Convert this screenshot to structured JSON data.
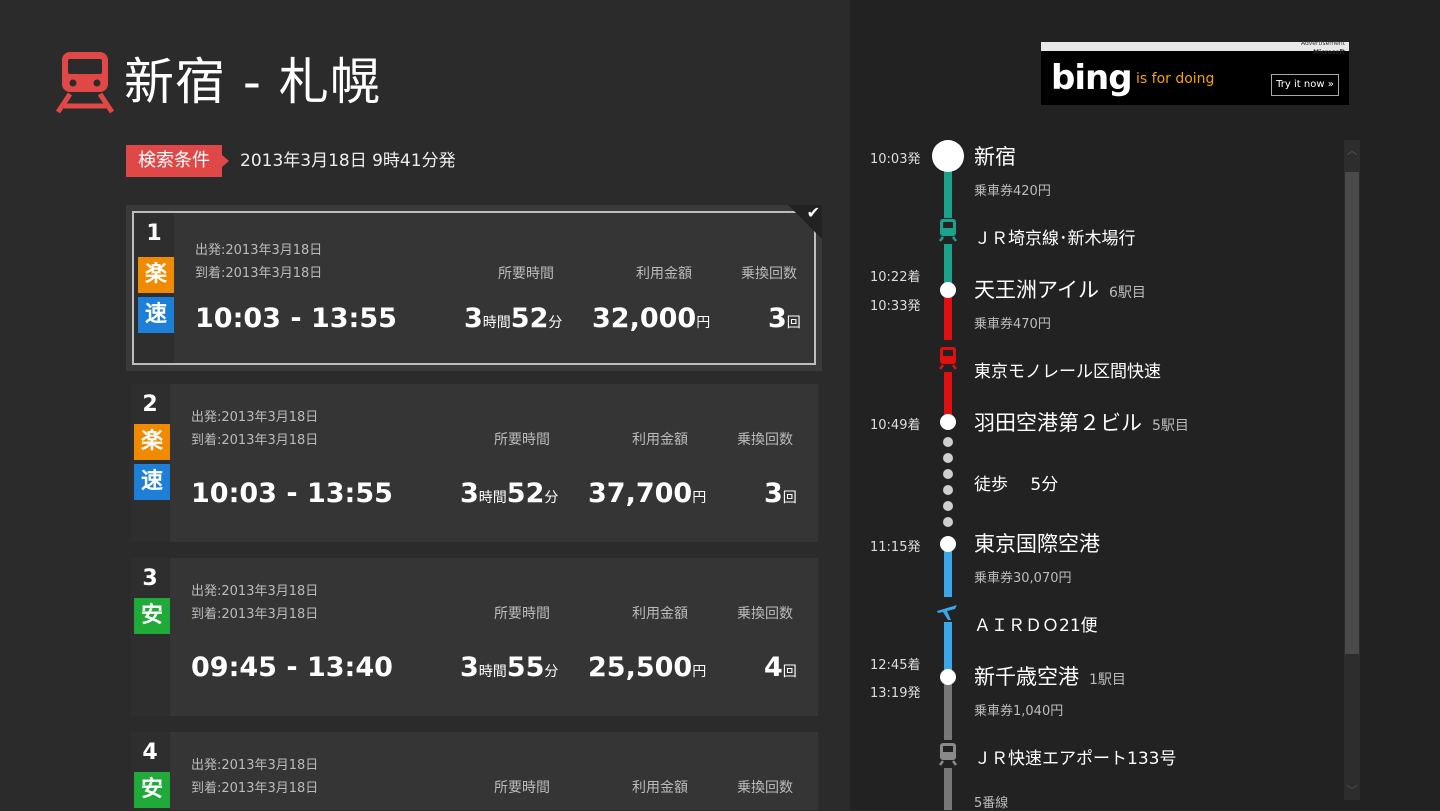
{
  "header": {
    "title": "新宿 - 札幌"
  },
  "search": {
    "badge": "検索条件",
    "condition": "2013年3月18日 9時41分発"
  },
  "column_headers": {
    "duration": "所要時間",
    "fare": "利用金額",
    "transfers": "乗換回数"
  },
  "colors": {
    "accent_red": "#e04848",
    "tag_orange": "#f08a00",
    "tag_blue": "#1e7fd8",
    "tag_green": "#1faa3a",
    "line_green": "#1aa38a",
    "line_red": "#e01010",
    "line_blue": "#3ba6e8",
    "line_gray": "#777777"
  },
  "routes": [
    {
      "rank": "1",
      "departure": "出発:2013年3月18日",
      "arrival": "到着:2013年3月18日",
      "tags": [
        "楽",
        "速"
      ],
      "times": "10:03 - 13:55",
      "dur_h": "3",
      "dur_h_unit": "時間",
      "dur_m": "52",
      "dur_m_unit": "分",
      "fare": "32,000",
      "fare_unit": "円",
      "transfers": "3",
      "transfers_unit": "回",
      "selected": true
    },
    {
      "rank": "2",
      "departure": "出発:2013年3月18日",
      "arrival": "到着:2013年3月18日",
      "tags": [
        "楽",
        "速"
      ],
      "times": "10:03 - 13:55",
      "dur_h": "3",
      "dur_h_unit": "時間",
      "dur_m": "52",
      "dur_m_unit": "分",
      "fare": "37,700",
      "fare_unit": "円",
      "transfers": "3",
      "transfers_unit": "回"
    },
    {
      "rank": "3",
      "departure": "出発:2013年3月18日",
      "arrival": "到着:2013年3月18日",
      "tags": [
        "安"
      ],
      "times": "09:45 - 13:40",
      "dur_h": "3",
      "dur_h_unit": "時間",
      "dur_m": "55",
      "dur_m_unit": "分",
      "fare": "25,500",
      "fare_unit": "円",
      "transfers": "4",
      "transfers_unit": "回"
    },
    {
      "rank": "4",
      "departure": "出発:2013年3月18日",
      "arrival": "到着:2013年3月18日",
      "tags": [
        "安"
      ]
    }
  ],
  "ad": {
    "label": "Advertisement",
    "brand": "Microsoft",
    "logo": "bing",
    "tagline": "is for doing",
    "cta": "Try it now »"
  },
  "timeline": {
    "times": [
      "10:03発",
      "10:22着",
      "10:33発",
      "10:49着",
      "11:15発",
      "12:45着",
      "13:19発"
    ],
    "stations": [
      "新宿",
      "天王洲アイル",
      "羽田空港第２ビル",
      "東京国際空港",
      "新千歳空港"
    ],
    "fares": [
      "乗車券420円",
      "乗車券470円",
      "乗車券30,070円",
      "乗車券1,040円"
    ],
    "stops": [
      "6駅目",
      "5駅目",
      "1駅目"
    ],
    "lines": [
      "ＪＲ埼京線･新木場行",
      "東京モノレール区間快速",
      "ＡＩＲＤＯ21便",
      "ＪＲ快速エアポート133号"
    ],
    "walk": "徒歩　 5分",
    "platform": "5番線"
  }
}
